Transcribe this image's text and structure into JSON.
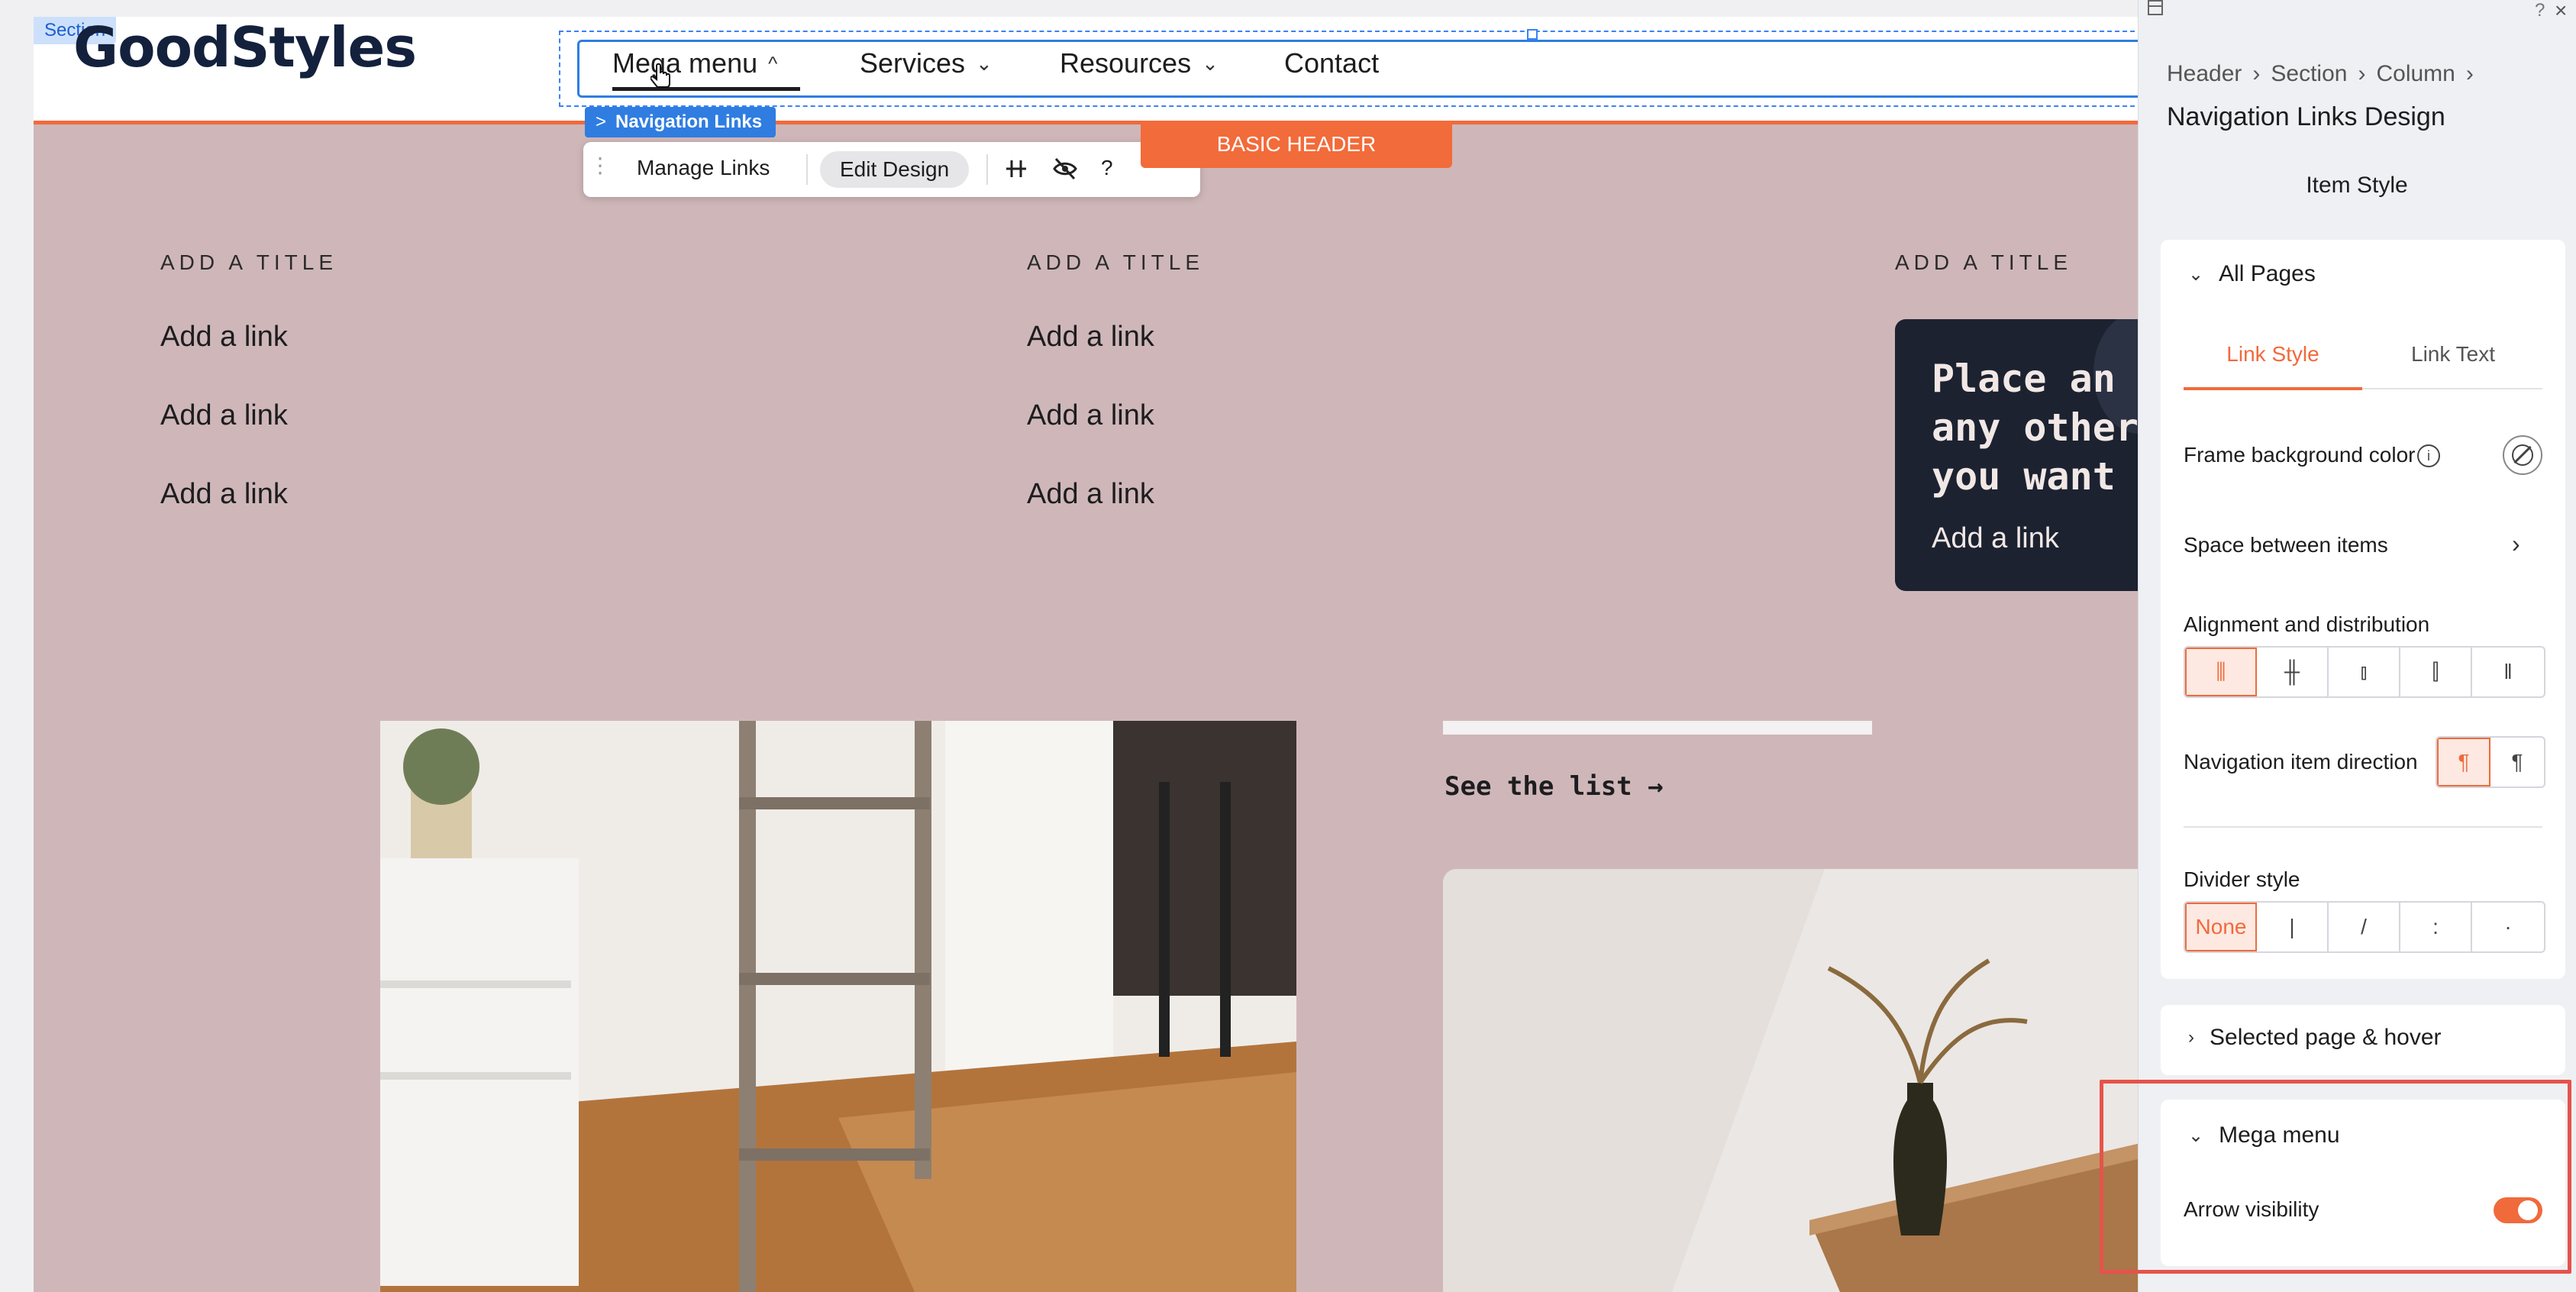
{
  "canvas": {
    "section_tag": "Section",
    "logo": "GoodStyles",
    "nav": [
      {
        "label": "Mega menu",
        "chevron": "^"
      },
      {
        "label": "Services",
        "chevron": "⌄"
      },
      {
        "label": "Resources",
        "chevron": "⌄"
      },
      {
        "label": "Contact"
      }
    ],
    "nav_chip": {
      "arrow": ">",
      "label": "Navigation Links"
    },
    "toolbar": {
      "manage_links": "Manage Links",
      "edit_design": "Edit Design",
      "help": "?",
      "more": "···"
    },
    "basic_header_tag": "BASIC HEADER",
    "columns": [
      {
        "title": "ADD A TITLE",
        "links": [
          "Add a link",
          "Add a link",
          "Add a link"
        ]
      },
      {
        "title": "ADD A TITLE",
        "links": [
          "Add a link",
          "Add a link",
          "Add a link"
        ]
      },
      {
        "title": "ADD A TITLE"
      }
    ],
    "dark_card": {
      "text": "Place an \nany other\nyou want",
      "link": "Add a link"
    },
    "see_list": "See the list →"
  },
  "panel": {
    "breadcrumb": [
      "Header",
      "›",
      "Section",
      "›",
      "Column",
      "›"
    ],
    "title": "Navigation Links Design",
    "item_style": "Item Style",
    "all_pages": {
      "arrow": "⌄",
      "label": "All Pages"
    },
    "tabs": {
      "link_style": "Link Style",
      "link_text": "Link Text"
    },
    "frame_bg_label": "Frame background color",
    "info_glyph": "i",
    "space_between_label": "Space between items",
    "space_between_chevron": "›",
    "alignment_label": "Alignment and distribution",
    "alignment_options": [
      "⫼",
      "╫",
      "⫾",
      "⫿",
      "‖"
    ],
    "direction_label": "Navigation item direction",
    "direction_options": [
      "¶",
      "¶"
    ],
    "divider_label": "Divider style",
    "divider_options": [
      "None",
      "|",
      "/",
      ":",
      "·"
    ],
    "selected_page": {
      "arrow": "›",
      "label": "Selected page & hover"
    },
    "mega_menu": {
      "arrow": "⌄",
      "label": "Mega menu"
    },
    "arrow_visibility_label": "Arrow visibility",
    "arrow_visibility_on": true,
    "help": "?",
    "close": "×"
  },
  "colors": {
    "accent": "#f06a3c",
    "selection_blue": "#2f7de1",
    "page_bg": "#cfb7b9",
    "highlight_red": "#e5534b"
  }
}
